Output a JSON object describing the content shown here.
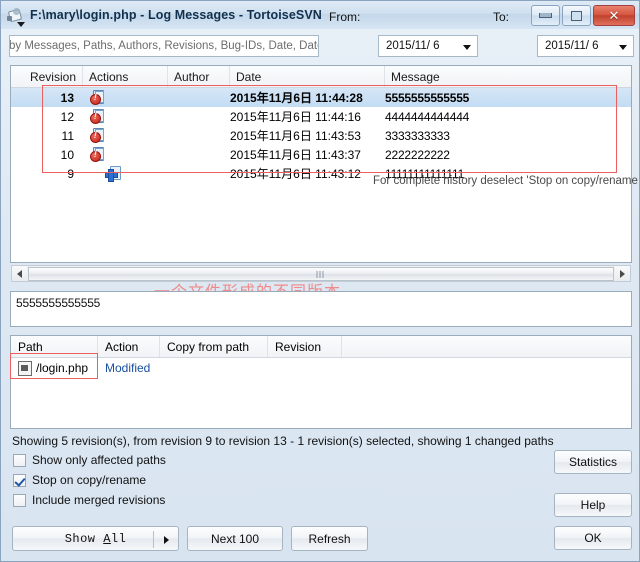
{
  "window": {
    "title": "F:\\mary\\login.php - Log Messages - TortoiseSVN",
    "minimize_label": "Minimize",
    "maximize_label": "Maximize",
    "close_label": "✕"
  },
  "filter": {
    "placeholder_visible": "by Messages, Paths, Authors, Revisions, Bug-IDs, Date, Date",
    "from_label": "From:",
    "to_label": "To:",
    "from_date": "2015/11/ 6",
    "to_date": "2015/11/ 6"
  },
  "revisions": {
    "columns": [
      "Revision",
      "Actions",
      "Author",
      "Date",
      "Message"
    ],
    "rows": [
      {
        "revision": "13",
        "action_icon": "modified-icon",
        "author": "",
        "date": "2015年11月6日 11:44:28",
        "message": "5555555555555",
        "selected": true
      },
      {
        "revision": "12",
        "action_icon": "modified-icon",
        "author": "",
        "date": "2015年11月6日 11:44:16",
        "message": "4444444444444",
        "selected": false
      },
      {
        "revision": "11",
        "action_icon": "modified-icon",
        "author": "",
        "date": "2015年11月6日 11:43:53",
        "message": "3333333333",
        "selected": false
      },
      {
        "revision": "10",
        "action_icon": "modified-icon",
        "author": "",
        "date": "2015年11月6日 11:43:37",
        "message": "2222222222",
        "selected": false
      },
      {
        "revision": "9",
        "action_icon": "added-icon",
        "author": "",
        "date": "2015年11月6日 11:43:12",
        "message": "11111111111111",
        "selected": false
      }
    ],
    "hint": "For complete history deselect 'Stop on copy/rename",
    "annotation": "一个文件形成的不同版本",
    "annotation_color": "#ef8a8a"
  },
  "message_box": {
    "value": "5555555555555"
  },
  "paths": {
    "columns": [
      "Path",
      "Action",
      "Copy from path",
      "Revision"
    ],
    "rows": [
      {
        "path": "/login.php",
        "action": "Modified",
        "copy_from_path": "",
        "revision": "",
        "icon": "file-icon"
      }
    ],
    "action_color": "#1a4fa0"
  },
  "status": {
    "text": "Showing 5 revision(s), from revision 9 to revision 13 - 1 revision(s) selected, showing 1 changed paths"
  },
  "options": [
    {
      "label": "Show only affected paths",
      "checked": false
    },
    {
      "label": "Stop on copy/rename",
      "checked": true
    },
    {
      "label": "Include merged revisions",
      "checked": false
    }
  ],
  "buttons": {
    "statistics": "Statistics",
    "help": "Help",
    "ok": "OK",
    "show_all_prefix": "Show ",
    "show_all_accel": "A",
    "show_all_suffix": "ll",
    "next_100": "Next 100",
    "refresh": "Refresh"
  }
}
